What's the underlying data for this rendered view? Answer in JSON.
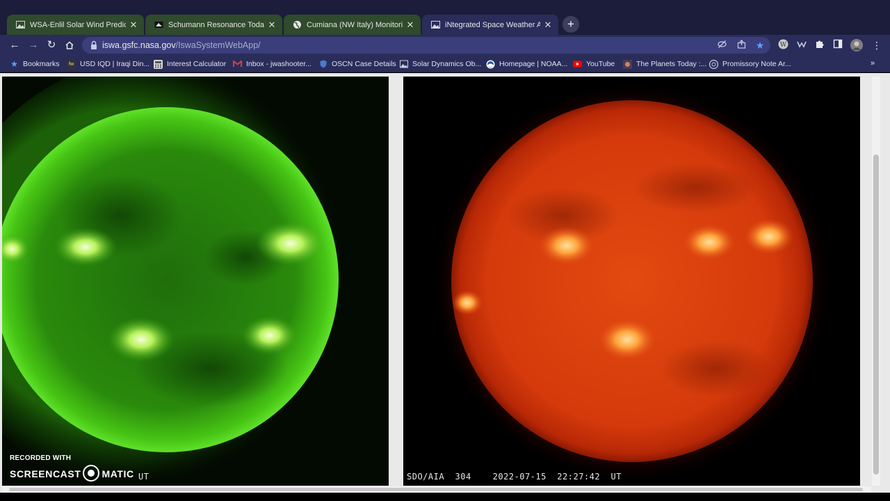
{
  "browser": {
    "tabs": [
      {
        "title": "WSA-Enlil Solar Wind Prediction",
        "favicon": "image-icon",
        "state": "inactive"
      },
      {
        "title": "Schumann Resonance Today ⚡",
        "favicon": "image-icon",
        "state": "inactive"
      },
      {
        "title": "Cumiana (NW Italy) Monitoring S",
        "favicon": "globe-icon",
        "state": "inactive"
      },
      {
        "title": "iNtegrated Space Weather Analy",
        "favicon": "image-icon",
        "state": "active"
      }
    ],
    "new_tab_label": "+",
    "address": {
      "host": "iswa.gsfc.nasa.gov",
      "path": "/IswaSystemWebApp/"
    },
    "bookmarks": [
      {
        "label": "Bookmarks",
        "icon": "star-icon"
      },
      {
        "label": "USD IQD | Iraqi Din...",
        "icon": "logo-icon"
      },
      {
        "label": "Interest Calculator",
        "icon": "calculator-icon"
      },
      {
        "label": "Inbox - jwashooter...",
        "icon": "gmail-icon"
      },
      {
        "label": "OSCN Case Details",
        "icon": "shield-icon"
      },
      {
        "label": "Solar Dynamics Ob...",
        "icon": "image-icon"
      },
      {
        "label": "Homepage | NOAA...",
        "icon": "noaa-icon"
      },
      {
        "label": "YouTube",
        "icon": "youtube-icon"
      },
      {
        "label": "The Planets Today :...",
        "icon": "planet-icon"
      },
      {
        "label": "Promissory Note Ar...",
        "icon": "document-icon"
      }
    ],
    "bookmarks_overflow": "»"
  },
  "page": {
    "left_image": {
      "description_icon": "sun-green-euv",
      "caption": "UT"
    },
    "right_image": {
      "caption": "SDO/AIA  304    2022-07-15  22:27:42  UT"
    }
  },
  "watermark": {
    "line1": "RECORDED WITH",
    "line2_a": "SCREENCAST",
    "line2_b": "MATIC"
  },
  "colors": {
    "tabstrip": "#1b1d3a",
    "toolbar": "#2a2d5a",
    "omnibox": "#3a3e7a",
    "sun_green": "#3bbf10",
    "sun_red": "#e8430c"
  }
}
